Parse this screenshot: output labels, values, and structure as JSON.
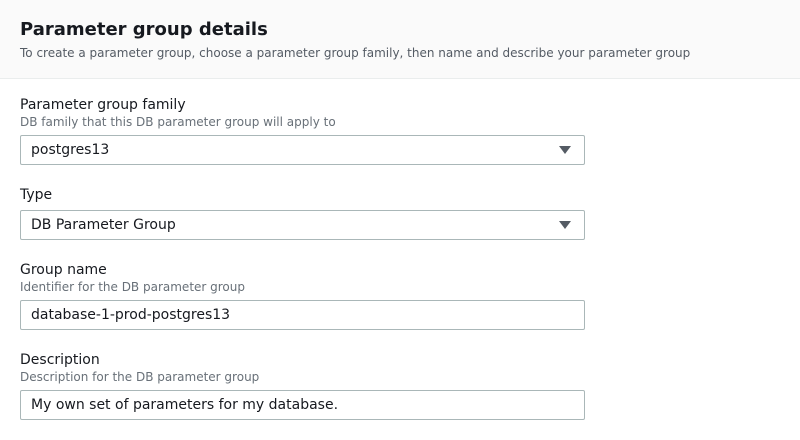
{
  "header": {
    "title": "Parameter group details",
    "description": "To create a parameter group, choose a parameter group family, then name and describe your parameter group"
  },
  "fields": {
    "family": {
      "label": "Parameter group family",
      "hint": "DB family that this DB parameter group will apply to",
      "value": "postgres13",
      "icon": "chevron-down-icon"
    },
    "type": {
      "label": "Type",
      "value": "DB Parameter Group",
      "icon": "chevron-down-icon"
    },
    "group_name": {
      "label": "Group name",
      "hint": "Identifier for the DB parameter group",
      "value": "database-1-prod-postgres13"
    },
    "description": {
      "label": "Description",
      "hint": "Description for the DB parameter group",
      "value": "My own set of parameters for my database."
    }
  },
  "colors": {
    "header_bg": "#fafafa",
    "border": "#aab7b8",
    "text": "#16191f",
    "hint": "#687078"
  }
}
